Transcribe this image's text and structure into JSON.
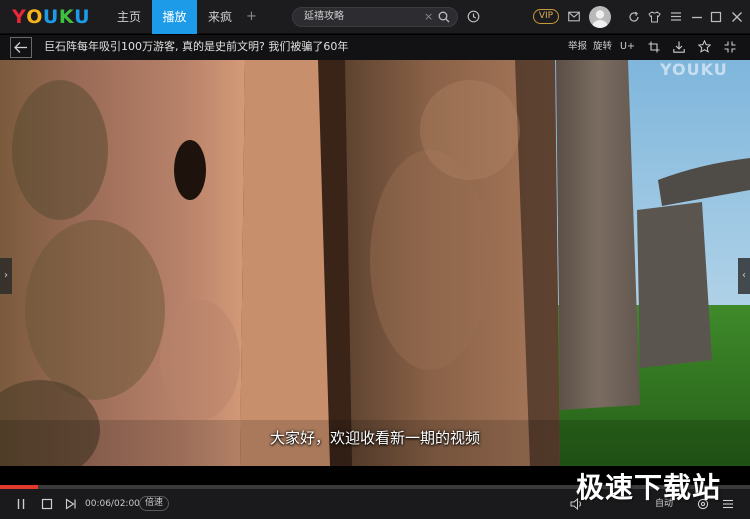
{
  "app": {
    "logo_letters": [
      "Y",
      "O",
      "U",
      "K",
      "U"
    ],
    "logo_colors": [
      "#e8283a",
      "#f4b41a",
      "#1e9be8",
      "#3fbf3f",
      "#1e9be8"
    ]
  },
  "nav": {
    "tabs": [
      {
        "label": "主页",
        "active": false
      },
      {
        "label": "播放",
        "active": true
      },
      {
        "label": "来疯",
        "active": false
      }
    ],
    "add_label": "+"
  },
  "search": {
    "value": "延禧攻略"
  },
  "header": {
    "vip_label": "VIP"
  },
  "player": {
    "title": "巨石阵每年吸引100万游客, 真的是史前文明? 我们被骗了60年",
    "toolbar": {
      "report": "举报",
      "rotate": "旋转",
      "upgrade": "U+"
    },
    "watermark": "YOUKU",
    "subtitle": "大家好，欢迎收看新一期的视频",
    "time": "00:06/02:00",
    "progress": 0.05,
    "speed_label": "倍速",
    "auto_label": "自动"
  },
  "site_watermark": "极速下载站",
  "colors": {
    "accent": "#1e9be8",
    "progress": "#e03a2f",
    "vip": "#d9ad52"
  },
  "icons": [
    "search-icon",
    "history-icon",
    "mail-icon",
    "refresh-icon",
    "skin-icon",
    "menu-icon",
    "minimize-icon",
    "maximize-icon",
    "close-icon",
    "back-arrow-icon",
    "crop-icon",
    "download-icon",
    "star-icon",
    "fullscreen-exit-icon",
    "pause-icon",
    "stop-icon",
    "next-icon",
    "volume-icon",
    "settings-icon",
    "list-icon"
  ]
}
